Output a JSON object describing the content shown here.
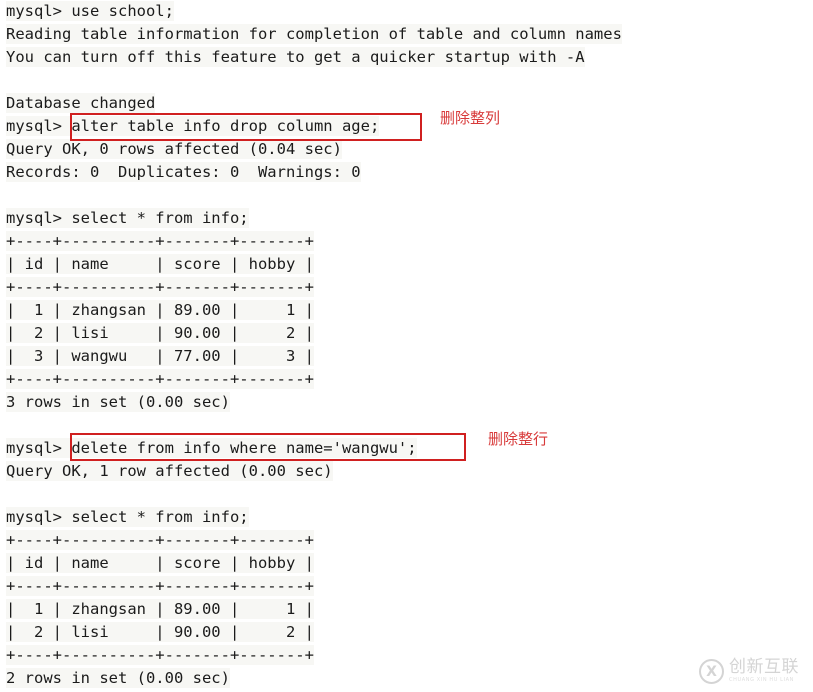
{
  "terminal": {
    "prompt": "mysql> ",
    "lines": [
      {
        "id": "l1",
        "text": "mysql> use school;"
      },
      {
        "id": "l2",
        "text": "Reading table information for completion of table and column names"
      },
      {
        "id": "l3",
        "text": "You can turn off this feature to get a quicker startup with -A"
      },
      {
        "id": "l4",
        "text": ""
      },
      {
        "id": "l5",
        "text": "Database changed"
      },
      {
        "id": "l6",
        "text": "mysql> alter table info drop column age;"
      },
      {
        "id": "l7",
        "text": "Query OK, 0 rows affected (0.04 sec)"
      },
      {
        "id": "l8",
        "text": "Records: 0  Duplicates: 0  Warnings: 0"
      },
      {
        "id": "l9",
        "text": ""
      },
      {
        "id": "l10",
        "text": "mysql> select * from info;"
      },
      {
        "id": "l11",
        "text": "+----+----------+-------+-------+"
      },
      {
        "id": "l12",
        "text": "| id | name     | score | hobby |"
      },
      {
        "id": "l13",
        "text": "+----+----------+-------+-------+"
      },
      {
        "id": "l14",
        "text": "|  1 | zhangsan | 89.00 |     1 |"
      },
      {
        "id": "l15",
        "text": "|  2 | lisi     | 90.00 |     2 |"
      },
      {
        "id": "l16",
        "text": "|  3 | wangwu   | 77.00 |     3 |"
      },
      {
        "id": "l17",
        "text": "+----+----------+-------+-------+"
      },
      {
        "id": "l18",
        "text": "3 rows in set (0.00 sec)"
      },
      {
        "id": "l19",
        "text": ""
      },
      {
        "id": "l20",
        "text": "mysql> delete from info where name='wangwu';"
      },
      {
        "id": "l21",
        "text": "Query OK, 1 row affected (0.00 sec)"
      },
      {
        "id": "l22",
        "text": ""
      },
      {
        "id": "l23",
        "text": "mysql> select * from info;"
      },
      {
        "id": "l24",
        "text": "+----+----------+-------+-------+"
      },
      {
        "id": "l25",
        "text": "| id | name     | score | hobby |"
      },
      {
        "id": "l26",
        "text": "+----+----------+-------+-------+"
      },
      {
        "id": "l27",
        "text": "|  1 | zhangsan | 89.00 |     1 |"
      },
      {
        "id": "l28",
        "text": "|  2 | lisi     | 90.00 |     2 |"
      },
      {
        "id": "l29",
        "text": "+----+----------+-------+-------+"
      },
      {
        "id": "l30",
        "text": "2 rows in set (0.00 sec)"
      }
    ]
  },
  "commands": {
    "drop_column": "alter table info drop column age;",
    "delete_row": "delete from info where name='wangwu';"
  },
  "tables": {
    "first": {
      "headers": [
        "id",
        "name",
        "score",
        "hobby"
      ],
      "rows": [
        [
          "1",
          "zhangsan",
          "89.00",
          "1"
        ],
        [
          "2",
          "lisi",
          "90.00",
          "2"
        ],
        [
          "3",
          "wangwu",
          "77.00",
          "3"
        ]
      ],
      "footer": "3 rows in set (0.00 sec)"
    },
    "second": {
      "headers": [
        "id",
        "name",
        "score",
        "hobby"
      ],
      "rows": [
        [
          "1",
          "zhangsan",
          "89.00",
          "1"
        ],
        [
          "2",
          "lisi",
          "90.00",
          "2"
        ]
      ],
      "footer": "2 rows in set (0.00 sec)"
    }
  },
  "annotations": [
    {
      "id": "a1",
      "text": "删除整列",
      "color": "#d83a3a"
    },
    {
      "id": "a2",
      "text": "删除整行",
      "color": "#d83a3a"
    }
  ],
  "watermark": {
    "logo_letter": "X",
    "zh": "创新互联",
    "pinyin": "CHUANG XIN HU LIAN"
  },
  "colors": {
    "text": "#1b1b1b",
    "line_background": "#f7f7f4",
    "page_background": "#ffffff",
    "highlight_border": "#d02020",
    "annotation": "#d83a3a",
    "watermark": "#9a9a9a"
  }
}
